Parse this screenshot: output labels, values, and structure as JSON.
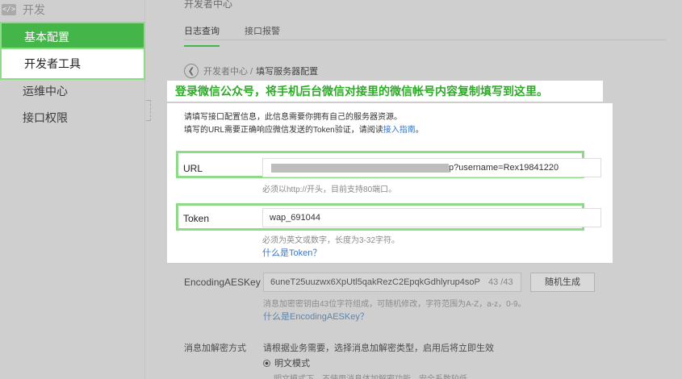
{
  "sidebar": {
    "header": "开发",
    "header_icon": "code-icon",
    "items": [
      {
        "label": "基本配置"
      },
      {
        "label": "开发者工具"
      },
      {
        "label": "运维中心"
      },
      {
        "label": "接口权限"
      }
    ]
  },
  "main": {
    "title": "开发者中心",
    "tabs": [
      {
        "label": "日志查询"
      },
      {
        "label": "接口报警"
      }
    ],
    "breadcrumb": {
      "parent": "开发者中心 /",
      "current": "填写服务器配置"
    }
  },
  "annotation": "登录微信公众号，将手机后台微信对接里的微信帐号内容复制填写到这里。",
  "panel": {
    "intro_line1": "请填写接口配置信息，此信息需要你拥有自己的服务器资源。",
    "intro_line2": "填写的URL需要正确响应微信发送的Token验证，请阅读",
    "intro_link": "接入指南",
    "intro_end": "。",
    "url": {
      "label": "URL",
      "value_suffix": "p?username=Rex19841220",
      "hint": "必须以http://开头，目前支持80端口。"
    },
    "token": {
      "label": "Token",
      "value": "wap_691044",
      "hint": "必须为英文或数字，长度为3-32字符。",
      "link": "什么是Token？"
    }
  },
  "aes": {
    "label": "EncodingAESKey",
    "value": "6uneT25uuzwx6XpUtl5qakRezC2EpqkGdhlyrup4soP",
    "count": "43 /43",
    "button": "随机生成",
    "hint": "消息加密密钥由43位字符组成，可随机修改，字符范围为A-Z，a-z，0-9。",
    "link": "什么是EncodingAESKey？"
  },
  "encryption": {
    "label": "消息加解密方式",
    "desc": "请根据业务需要，选择消息加解密类型，启用后将立即生效",
    "option": "明文模式",
    "option_hint": "明文模式下，不使用消息体加解密功能，安全系数较低"
  },
  "colors": {
    "accent": "#44b549",
    "highlight": "#8fda86",
    "link": "#3c76c4"
  }
}
